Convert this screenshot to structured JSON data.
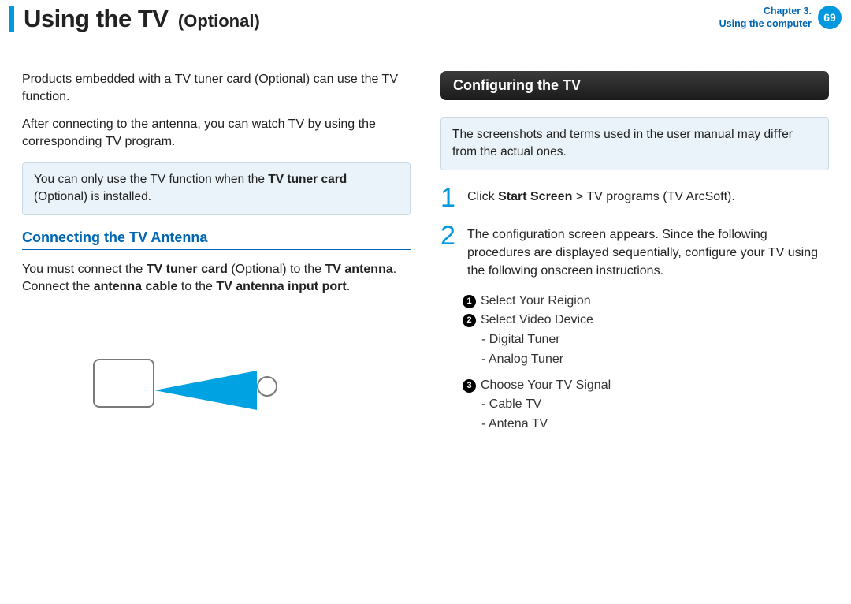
{
  "header": {
    "title": "Using the TV",
    "subtitle": "(Optional)",
    "chapter_line1": "Chapter 3.",
    "chapter_line2": "Using the computer",
    "page_number": "69"
  },
  "left": {
    "intro1": "Products embedded with a TV tuner card (Optional) can use the TV function.",
    "intro2": "After connecting to the antenna, you can watch TV by using the corresponding TV program.",
    "callout_pre": "You can only use the TV function when the ",
    "callout_bold": "TV tuner card",
    "callout_post": " (Optional) is installed.",
    "section_title": "Connecting the TV Antenna",
    "antenna_1": "You must connect the ",
    "antenna_b1": "TV tuner card",
    "antenna_2": " (Optional) to the ",
    "antenna_b2": "TV antenna",
    "antenna_3": ". Connect the ",
    "antenna_b3": "antenna cable",
    "antenna_4": " to the ",
    "antenna_b4": "TV antenna input port",
    "antenna_5": "."
  },
  "right": {
    "bar_title": "Conﬁguring the TV",
    "callout": "The screenshots and terms used in the user manual may diﬀer from the actual ones.",
    "step1_num": "1",
    "step1_pre": "Click ",
    "step1_bold": "Start Screen",
    "step1_post": " > TV programs (TV ArcSoft).",
    "step2_num": "2",
    "step2_text": "The conﬁguration screen appears. Since the following procedures are displayed sequentially, conﬁgure your TV using the following onscreen instructions.",
    "o1": "Select Your Reigion",
    "o2": "Select Video Device",
    "o2a": "- Digital Tuner",
    "o2b": "- Analog Tuner",
    "o3": "Choose Your TV Signal",
    "o3a": "- Cable TV",
    "o3b": "- Antena TV"
  }
}
